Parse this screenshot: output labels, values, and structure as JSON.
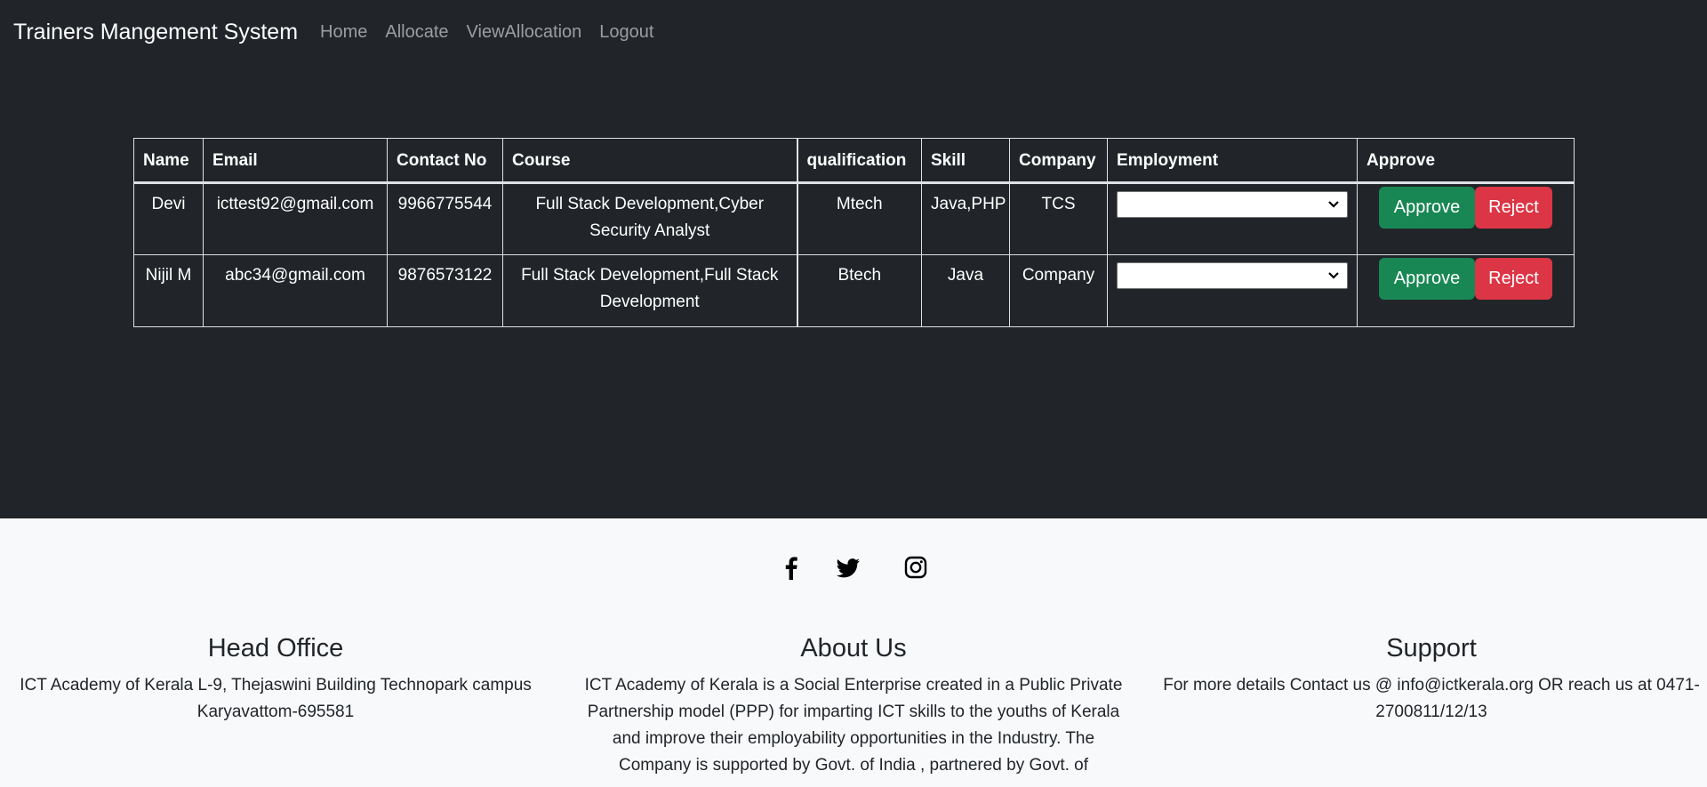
{
  "nav": {
    "brand": "Trainers Mangement System",
    "links": [
      "Home",
      "Allocate",
      "ViewAllocation",
      "Logout"
    ]
  },
  "table": {
    "headers": [
      "Name",
      "Email",
      "Contact No",
      "Course",
      "qualification",
      "Skill",
      "Company",
      "Employment",
      "Approve"
    ],
    "rows": [
      {
        "name": "Devi",
        "email": "icttest92@gmail.com",
        "contact": "9966775544",
        "course": "Full Stack Development,Cyber Security Analyst",
        "qualification": "Mtech",
        "skill": "Java,PHP",
        "company": "TCS",
        "employment": "",
        "approve_label": "Approve",
        "reject_label": "Reject"
      },
      {
        "name": "Nijil M",
        "email": "abc34@gmail.com",
        "contact": "9876573122",
        "course": "Full Stack Development,Full Stack Development",
        "qualification": "Btech",
        "skill": "Java",
        "company": "Company",
        "employment": "",
        "approve_label": "Approve",
        "reject_label": "Reject"
      }
    ]
  },
  "footer": {
    "social_icons": [
      "facebook-icon",
      "twitter-icon",
      "instagram-icon"
    ],
    "head_office": {
      "title": "Head Office",
      "text": "ICT Academy of Kerala L-9, Thejaswini Building Technopark campus Karyavattom-695581"
    },
    "about": {
      "title": "About Us",
      "text": "ICT Academy of Kerala is a Social Enterprise created in a Public Private Partnership model (PPP) for imparting ICT skills to the youths of Kerala and improve their employability opportunities in the Industry. The Company is supported by Govt. of India , partnered by Govt. of"
    },
    "support": {
      "title": "Support",
      "text": "For more details Contact us @ info@ictkerala.org OR reach us at 0471-2700811/12/13"
    }
  },
  "colors": {
    "dark_bg": "#212529",
    "footer_bg": "#f8f9fa",
    "approve": "#198754",
    "reject": "#dc3545"
  }
}
